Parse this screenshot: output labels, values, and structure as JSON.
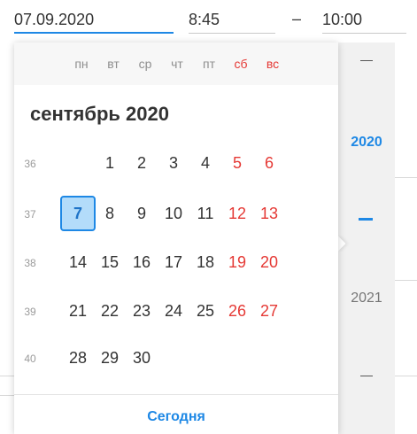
{
  "inputs": {
    "date_value": "07.09.2020",
    "time_start_value": "8:45",
    "time_separator": "–",
    "time_end_value": "10:00"
  },
  "calendar": {
    "weekdays": [
      {
        "label": "пн",
        "weekend": false
      },
      {
        "label": "вт",
        "weekend": false
      },
      {
        "label": "ср",
        "weekend": false
      },
      {
        "label": "чт",
        "weekend": false
      },
      {
        "label": "пт",
        "weekend": false
      },
      {
        "label": "сб",
        "weekend": true
      },
      {
        "label": "вс",
        "weekend": true
      }
    ],
    "month_title": "сентябрь 2020",
    "weeks": [
      {
        "num": "36",
        "days": [
          "",
          "1",
          "2",
          "3",
          "4",
          "5",
          "6"
        ]
      },
      {
        "num": "37",
        "days": [
          "7",
          "8",
          "9",
          "10",
          "11",
          "12",
          "13"
        ]
      },
      {
        "num": "38",
        "days": [
          "14",
          "15",
          "16",
          "17",
          "18",
          "19",
          "20"
        ]
      },
      {
        "num": "39",
        "days": [
          "21",
          "22",
          "23",
          "24",
          "25",
          "26",
          "27"
        ]
      },
      {
        "num": "40",
        "days": [
          "28",
          "29",
          "30",
          "",
          "",
          "",
          ""
        ]
      }
    ],
    "selected_day": "7",
    "today_label": "Сегодня"
  },
  "year_picker": {
    "years": [
      "2020",
      "2021"
    ],
    "active_year": "2020"
  },
  "colors": {
    "accent": "#1e88e5",
    "weekend": "#e53935",
    "selected_bg": "#b3dcfa"
  }
}
